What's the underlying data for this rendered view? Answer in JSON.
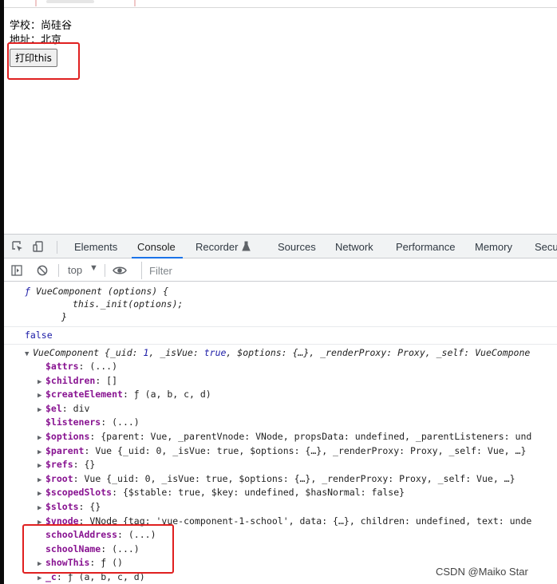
{
  "page": {
    "school_line": "学校：尚硅谷",
    "address_line": "地址：北京",
    "print_button": "打印this"
  },
  "devtools": {
    "tabs": [
      "Elements",
      "Console",
      "Recorder",
      "Sources",
      "Network",
      "Performance",
      "Memory",
      "Secu"
    ],
    "active_tab": "Console",
    "context": "top",
    "filter_placeholder": "Filter",
    "flask_icon": "flask-icon"
  },
  "console": {
    "fn_line1": "VueComponent (options) {",
    "fn_line2": "this._init(options);",
    "fn_line3": "}",
    "false_line": "false",
    "vc_header": {
      "name": "VueComponent",
      "uid_key": "{_uid",
      "uid_val": "1",
      "isvue_key": "_isVue",
      "isvue_val": "true",
      "options_key": "$options",
      "options_val": "{…}",
      "proxy_key": "_renderProxy",
      "proxy_val": "Proxy",
      "self_key": "_self",
      "self_val": "VueCompone"
    },
    "props": [
      {
        "key": "$attrs",
        "val": "(...)",
        "expandable": false
      },
      {
        "key": "$children",
        "val": "[]",
        "expandable": true
      },
      {
        "key": "$createElement",
        "val": "ƒ (a, b, c, d)",
        "expandable": true
      },
      {
        "key": "$el",
        "val": "div",
        "expandable": true
      },
      {
        "key": "$listeners",
        "val": "(...)",
        "expandable": false
      },
      {
        "key": "$options",
        "val": "{parent: Vue, _parentVnode: VNode, propsData: undefined, _parentListeners: und",
        "expandable": true
      },
      {
        "key": "$parent",
        "val": "Vue {_uid: 0, _isVue: true, $options: {…}, _renderProxy: Proxy, _self: Vue, …}",
        "expandable": true
      },
      {
        "key": "$refs",
        "val": "{}",
        "expandable": true
      },
      {
        "key": "$root",
        "val": "Vue {_uid: 0, _isVue: true, $options: {…}, _renderProxy: Proxy, _self: Vue, …}",
        "expandable": true
      },
      {
        "key": "$scopedSlots",
        "val": "{$stable: true, $key: undefined, $hasNormal: false}",
        "expandable": true
      },
      {
        "key": "$slots",
        "val": "{}",
        "expandable": true
      },
      {
        "key": "$vnode",
        "val": "VNode {tag: 'vue-component-1-school', data: {…}, children: undefined, text: unde",
        "expandable": true
      },
      {
        "key": "schoolAddress",
        "val": "(...)",
        "expandable": false
      },
      {
        "key": "schoolName",
        "val": "(...)",
        "expandable": false
      },
      {
        "key": "showThis",
        "val": "ƒ ()",
        "expandable": true
      },
      {
        "key": "_c",
        "val": "ƒ (a, b, c, d)",
        "expandable": true
      }
    ]
  },
  "watermark": "CSDN @Maiko Star",
  "colors": {
    "highlight": "#e02020",
    "accent": "#1a73e8",
    "key_purple": "#881391",
    "string_red": "#c80000"
  }
}
